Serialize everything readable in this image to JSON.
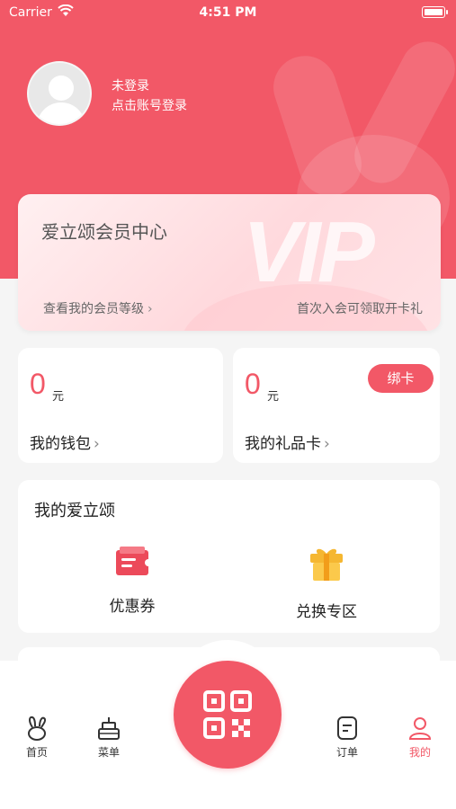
{
  "status_bar": {
    "carrier": "Carrier",
    "time": "4:51 PM"
  },
  "profile": {
    "login_status": "未登录",
    "login_hint": "点击账号登录"
  },
  "vip_card": {
    "title": "爱立颂会员中心",
    "watermark": "VIP",
    "level_link": "查看我的会员等级",
    "gift_text": "首次入会可领取开卡礼"
  },
  "wallet": {
    "amount": "0",
    "unit": "元",
    "label": "我的钱包"
  },
  "gift_card": {
    "amount": "0",
    "unit": "元",
    "label": "我的礼品卡",
    "bind_label": "绑卡"
  },
  "my_section": {
    "title": "我的爱立颂",
    "features": [
      {
        "label": "优惠券",
        "icon": "coupon-icon"
      },
      {
        "label": "兑换专区",
        "icon": "gift-box-icon"
      }
    ]
  },
  "tab_bar": {
    "tabs": [
      {
        "label": "首页",
        "icon": "rabbit-icon",
        "active": false
      },
      {
        "label": "菜单",
        "icon": "cake-icon",
        "active": false
      },
      {
        "label": "订单",
        "icon": "order-icon",
        "active": false
      },
      {
        "label": "我的",
        "icon": "user-icon",
        "active": true
      }
    ],
    "center_icon": "qr-code-icon"
  },
  "colors": {
    "brand": "#f25867",
    "coupon": "#ec4a5a",
    "gift": "#f5b731",
    "background": "#f5f5f5"
  }
}
